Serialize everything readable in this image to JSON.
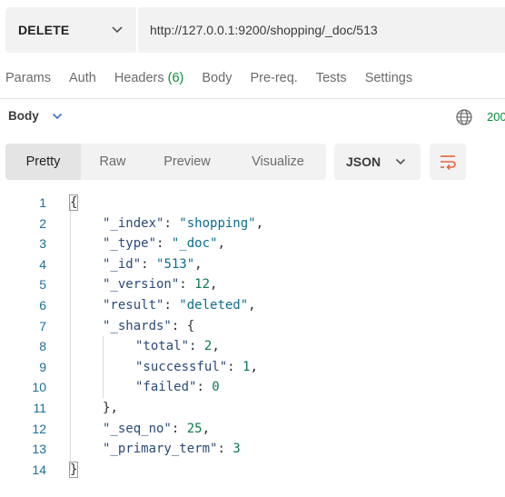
{
  "request": {
    "method": "DELETE",
    "url": "http://127.0.0.1:9200/shopping/_doc/513"
  },
  "request_tabs": [
    {
      "label": "Params",
      "count": ""
    },
    {
      "label": "Auth",
      "count": ""
    },
    {
      "label": "Headers",
      "count": "(6)"
    },
    {
      "label": "Body",
      "count": ""
    },
    {
      "label": "Pre-req.",
      "count": ""
    },
    {
      "label": "Tests",
      "count": ""
    },
    {
      "label": "Settings",
      "count": ""
    }
  ],
  "response": {
    "section_label": "Body",
    "status_text": "200",
    "views": [
      "Pretty",
      "Raw",
      "Preview",
      "Visualize"
    ],
    "active_view": "Pretty",
    "format": "JSON"
  },
  "code_lines": [
    {
      "n": "1",
      "indent": 0,
      "tokens": [
        {
          "t": "{",
          "c": "p"
        }
      ]
    },
    {
      "n": "2",
      "indent": 1,
      "tokens": [
        {
          "t": "\"_index\"",
          "c": "k"
        },
        {
          "t": ": ",
          "c": "p"
        },
        {
          "t": "\"shopping\"",
          "c": "s"
        },
        {
          "t": ",",
          "c": "p"
        }
      ]
    },
    {
      "n": "3",
      "indent": 1,
      "tokens": [
        {
          "t": "\"_type\"",
          "c": "k"
        },
        {
          "t": ": ",
          "c": "p"
        },
        {
          "t": "\"_doc\"",
          "c": "s"
        },
        {
          "t": ",",
          "c": "p"
        }
      ]
    },
    {
      "n": "4",
      "indent": 1,
      "tokens": [
        {
          "t": "\"_id\"",
          "c": "k"
        },
        {
          "t": ": ",
          "c": "p"
        },
        {
          "t": "\"513\"",
          "c": "s"
        },
        {
          "t": ",",
          "c": "p"
        }
      ]
    },
    {
      "n": "5",
      "indent": 1,
      "tokens": [
        {
          "t": "\"_version\"",
          "c": "k"
        },
        {
          "t": ": ",
          "c": "p"
        },
        {
          "t": "12",
          "c": "n"
        },
        {
          "t": ",",
          "c": "p"
        }
      ]
    },
    {
      "n": "6",
      "indent": 1,
      "tokens": [
        {
          "t": "\"result\"",
          "c": "k"
        },
        {
          "t": ": ",
          "c": "p"
        },
        {
          "t": "\"deleted\"",
          "c": "s"
        },
        {
          "t": ",",
          "c": "p"
        }
      ]
    },
    {
      "n": "7",
      "indent": 1,
      "tokens": [
        {
          "t": "\"_shards\"",
          "c": "k"
        },
        {
          "t": ": ",
          "c": "p"
        },
        {
          "t": "{",
          "c": "p"
        }
      ]
    },
    {
      "n": "8",
      "indent": 2,
      "tokens": [
        {
          "t": "\"total\"",
          "c": "k"
        },
        {
          "t": ": ",
          "c": "p"
        },
        {
          "t": "2",
          "c": "n"
        },
        {
          "t": ",",
          "c": "p"
        }
      ]
    },
    {
      "n": "9",
      "indent": 2,
      "tokens": [
        {
          "t": "\"successful\"",
          "c": "k"
        },
        {
          "t": ": ",
          "c": "p"
        },
        {
          "t": "1",
          "c": "n"
        },
        {
          "t": ",",
          "c": "p"
        }
      ]
    },
    {
      "n": "10",
      "indent": 2,
      "tokens": [
        {
          "t": "\"failed\"",
          "c": "k"
        },
        {
          "t": ": ",
          "c": "p"
        },
        {
          "t": "0",
          "c": "n"
        }
      ]
    },
    {
      "n": "11",
      "indent": 1,
      "tokens": [
        {
          "t": "}",
          "c": "p"
        },
        {
          "t": ",",
          "c": "p"
        }
      ]
    },
    {
      "n": "12",
      "indent": 1,
      "tokens": [
        {
          "t": "\"_seq_no\"",
          "c": "k"
        },
        {
          "t": ": ",
          "c": "p"
        },
        {
          "t": "25",
          "c": "n"
        },
        {
          "t": ",",
          "c": "p"
        }
      ]
    },
    {
      "n": "13",
      "indent": 1,
      "tokens": [
        {
          "t": "\"_primary_term\"",
          "c": "k"
        },
        {
          "t": ": ",
          "c": "p"
        },
        {
          "t": "3",
          "c": "n"
        }
      ]
    },
    {
      "n": "14",
      "indent": 0,
      "tokens": [
        {
          "t": "}",
          "c": "p"
        }
      ]
    }
  ],
  "icons": {
    "method_dropdown": "chevron-down-icon",
    "body_dropdown": "chevron-down-icon",
    "format_dropdown": "chevron-down-icon",
    "wrap": "wrap-lines-icon",
    "network": "globe-icon"
  },
  "colors": {
    "accent": "#e2653c",
    "status_ok": "#0a8f3c",
    "line_number": "#1e6f98",
    "json_key": "#2a4a7a",
    "json_string": "#0b6d8e",
    "json_number": "#0a7a4c"
  }
}
